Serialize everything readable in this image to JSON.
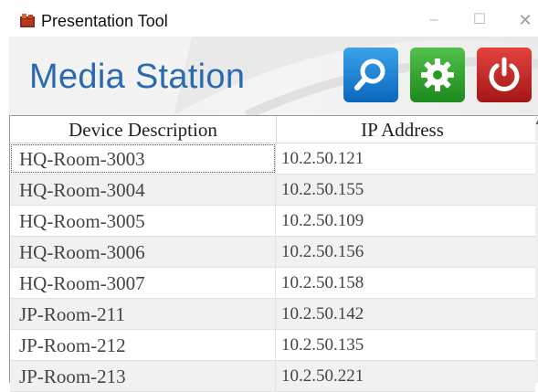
{
  "window": {
    "title": "Presentation Tool",
    "minimize_glyph": "–",
    "maximize_glyph": "☐",
    "close_glyph": "✕"
  },
  "header": {
    "app_title": "Media Station",
    "buttons": [
      {
        "name": "search",
        "icon": "search-icon",
        "color": "#1a7fd4"
      },
      {
        "name": "settings",
        "icon": "gear-icon",
        "color": "#2fa32b"
      },
      {
        "name": "power",
        "icon": "power-icon",
        "color": "#c42020"
      }
    ]
  },
  "table": {
    "columns": [
      "Device Description",
      "IP Address"
    ],
    "rows": [
      {
        "description": "HQ-Room-3003",
        "ip": "10.2.50.121"
      },
      {
        "description": "HQ-Room-3004",
        "ip": "10.2.50.155"
      },
      {
        "description": "HQ-Room-3005",
        "ip": "10.2.50.109"
      },
      {
        "description": "HQ-Room-3006",
        "ip": "10.2.50.156"
      },
      {
        "description": "HQ-Room-3007",
        "ip": "10.2.50.158"
      },
      {
        "description": "JP-Room-211",
        "ip": "10.2.50.142"
      },
      {
        "description": "JP-Room-212",
        "ip": "10.2.50.135"
      },
      {
        "description": "JP-Room-213",
        "ip": "10.2.50.221"
      }
    ]
  }
}
